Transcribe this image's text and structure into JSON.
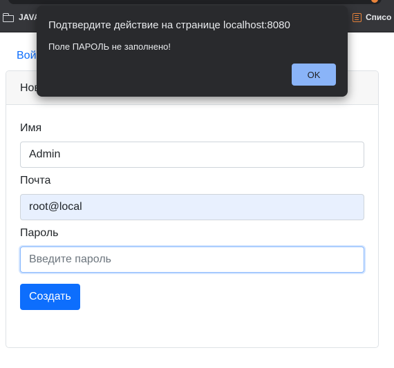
{
  "browser": {
    "bookmarks": [
      {
        "label": "JAVA",
        "icon": "folder-icon"
      },
      {
        "label": "Списо",
        "icon": "list-icon"
      }
    ]
  },
  "page": {
    "nav_link": "Вой",
    "card_header": "Нов",
    "form": {
      "name_label": "Имя",
      "name_value": "Admin",
      "email_label": "Почта",
      "email_value": "root@local",
      "password_label": "Пароль",
      "password_placeholder": "Введите пароль",
      "submit_label": "Создать"
    }
  },
  "dialog": {
    "title": "Подтвердите действие на странице localhost:8080",
    "message": "Поле ПАРОЛЬ не заполнено!",
    "ok_label": "OK"
  },
  "colors": {
    "primary": "#0d6efd",
    "dialog_bg": "#292a2d",
    "dialog_button": "#8ab4f8",
    "autofill_bg": "#e8f0fe"
  }
}
